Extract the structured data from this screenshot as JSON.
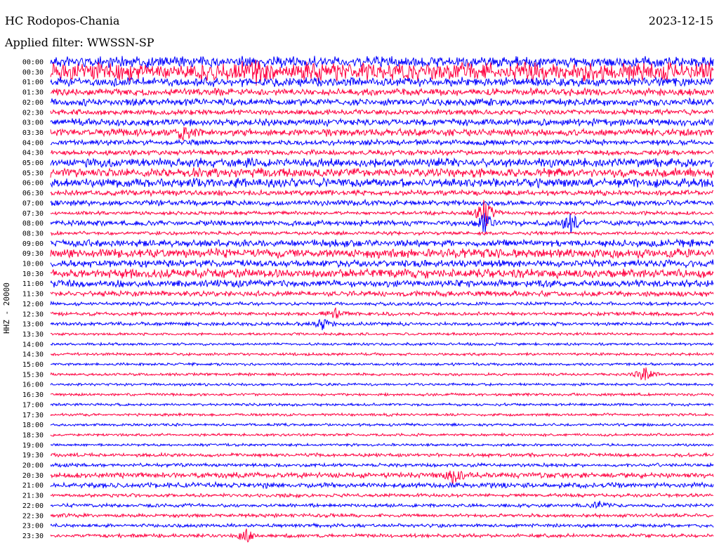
{
  "header": {
    "station": "HC Rodopos-Chania",
    "date": "2023-12-15",
    "filter": "Applied filter: WWSSN-SP"
  },
  "chart_data": {
    "type": "line",
    "ylabel": "HHZ - 20000",
    "row_labels": [
      "00:00",
      "00:30",
      "01:00",
      "01:30",
      "02:00",
      "02:30",
      "03:00",
      "03:30",
      "04:00",
      "04:30",
      "05:00",
      "05:30",
      "06:00",
      "06:30",
      "07:00",
      "07:30",
      "08:00",
      "08:30",
      "09:00",
      "09:30",
      "10:00",
      "10:30",
      "11:00",
      "11:30",
      "12:00",
      "12:30",
      "13:00",
      "13:30",
      "14:00",
      "14:30",
      "15:00",
      "15:30",
      "16:00",
      "16:30",
      "17:00",
      "17:30",
      "18:00",
      "18:30",
      "19:00",
      "19:30",
      "20:00",
      "20:30",
      "21:00",
      "21:30",
      "22:00",
      "22:30",
      "23:00",
      "23:30"
    ],
    "series_colors": [
      "#0000ff",
      "#ff0040"
    ],
    "amplitude_levels": [
      6,
      10,
      5,
      4,
      4,
      3,
      4,
      4,
      3,
      3,
      5,
      5,
      5,
      3,
      3,
      2,
      3,
      2,
      4,
      5,
      4,
      5,
      4,
      3,
      2,
      2,
      2,
      1.5,
      1.5,
      1.5,
      1.5,
      1.5,
      1.5,
      1.5,
      1.5,
      1.5,
      1.5,
      1.5,
      1.5,
      2,
      2,
      3,
      3,
      2,
      2,
      2,
      2,
      2
    ],
    "events": [
      {
        "row": 1,
        "x_fraction": 0.31,
        "amplitude": 14
      },
      {
        "row": 7,
        "x_fraction": 0.2,
        "amplitude": 10
      },
      {
        "row": 15,
        "x_fraction": 0.655,
        "amplitude": 24
      },
      {
        "row": 16,
        "x_fraction": 0.785,
        "amplitude": 12
      },
      {
        "row": 16,
        "x_fraction": 0.655,
        "amplitude": 14
      },
      {
        "row": 25,
        "x_fraction": 0.43,
        "amplitude": 10
      },
      {
        "row": 26,
        "x_fraction": 0.41,
        "amplitude": 9
      },
      {
        "row": 31,
        "x_fraction": 0.895,
        "amplitude": 12
      },
      {
        "row": 41,
        "x_fraction": 0.61,
        "amplitude": 14
      },
      {
        "row": 44,
        "x_fraction": 0.83,
        "amplitude": 7
      },
      {
        "row": 47,
        "x_fraction": 0.295,
        "amplitude": 10
      }
    ]
  }
}
